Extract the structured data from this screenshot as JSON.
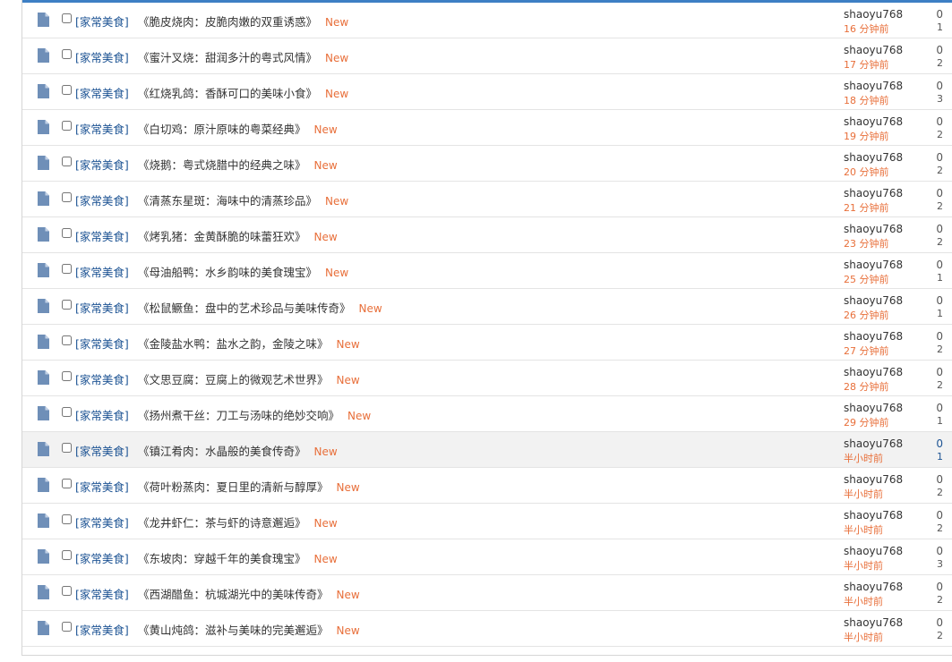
{
  "threads": [
    {
      "category": "[家常美食]",
      "title": "《脆皮烧肉：皮脆肉嫩的双重诱惑》",
      "badge": "New",
      "author": "shaoyu768",
      "time": "16 分钟前",
      "replies": "0",
      "views": "1"
    },
    {
      "category": "[家常美食]",
      "title": "《蜜汁叉烧：甜润多汁的粤式风情》",
      "badge": "New",
      "author": "shaoyu768",
      "time": "17 分钟前",
      "replies": "0",
      "views": "2"
    },
    {
      "category": "[家常美食]",
      "title": "《红烧乳鸽：香酥可口的美味小食》",
      "badge": "New",
      "author": "shaoyu768",
      "time": "18 分钟前",
      "replies": "0",
      "views": "3"
    },
    {
      "category": "[家常美食]",
      "title": "《白切鸡：原汁原味的粤菜经典》",
      "badge": "New",
      "author": "shaoyu768",
      "time": "19 分钟前",
      "replies": "0",
      "views": "2"
    },
    {
      "category": "[家常美食]",
      "title": "《烧鹅：粤式烧腊中的经典之味》",
      "badge": "New",
      "author": "shaoyu768",
      "time": "20 分钟前",
      "replies": "0",
      "views": "2"
    },
    {
      "category": "[家常美食]",
      "title": "《清蒸东星斑：海味中的清蒸珍品》",
      "badge": "New",
      "author": "shaoyu768",
      "time": "21 分钟前",
      "replies": "0",
      "views": "2"
    },
    {
      "category": "[家常美食]",
      "title": "《烤乳猪：金黄酥脆的味蕾狂欢》",
      "badge": "New",
      "author": "shaoyu768",
      "time": "23 分钟前",
      "replies": "0",
      "views": "2"
    },
    {
      "category": "[家常美食]",
      "title": "《母油船鸭：水乡韵味的美食瑰宝》",
      "badge": "New",
      "author": "shaoyu768",
      "time": "25 分钟前",
      "replies": "0",
      "views": "1"
    },
    {
      "category": "[家常美食]",
      "title": "《松鼠鳜鱼：盘中的艺术珍品与美味传奇》",
      "badge": "New",
      "author": "shaoyu768",
      "time": "26 分钟前",
      "replies": "0",
      "views": "1"
    },
    {
      "category": "[家常美食]",
      "title": "《金陵盐水鸭：盐水之韵，金陵之味》",
      "badge": "New",
      "author": "shaoyu768",
      "time": "27 分钟前",
      "replies": "0",
      "views": "2"
    },
    {
      "category": "[家常美食]",
      "title": "《文思豆腐：豆腐上的微观艺术世界》",
      "badge": "New",
      "author": "shaoyu768",
      "time": "28 分钟前",
      "replies": "0",
      "views": "2"
    },
    {
      "category": "[家常美食]",
      "title": "《扬州煮干丝：刀工与汤味的绝妙交响》",
      "badge": "New",
      "author": "shaoyu768",
      "time": "29 分钟前",
      "replies": "0",
      "views": "1"
    },
    {
      "category": "[家常美食]",
      "title": "《镇江肴肉：水晶般的美食传奇》",
      "badge": "New",
      "author": "shaoyu768",
      "time": "半小时前",
      "replies": "0",
      "views": "1",
      "hovered": true
    },
    {
      "category": "[家常美食]",
      "title": "《荷叶粉蒸肉：夏日里的清新与醇厚》",
      "badge": "New",
      "author": "shaoyu768",
      "time": "半小时前",
      "replies": "0",
      "views": "2"
    },
    {
      "category": "[家常美食]",
      "title": "《龙井虾仁：茶与虾的诗意邂逅》",
      "badge": "New",
      "author": "shaoyu768",
      "time": "半小时前",
      "replies": "0",
      "views": "2"
    },
    {
      "category": "[家常美食]",
      "title": "《东坡肉：穿越千年的美食瑰宝》",
      "badge": "New",
      "author": "shaoyu768",
      "time": "半小时前",
      "replies": "0",
      "views": "3"
    },
    {
      "category": "[家常美食]",
      "title": "《西湖醋鱼：杭城湖光中的美味传奇》",
      "badge": "New",
      "author": "shaoyu768",
      "time": "半小时前",
      "replies": "0",
      "views": "2"
    },
    {
      "category": "[家常美食]",
      "title": "《黄山炖鸽：滋补与美味的完美邂逅》",
      "badge": "New",
      "author": "shaoyu768",
      "time": "半小时前",
      "replies": "0",
      "views": "2"
    }
  ],
  "icons": {
    "row_icon": "document-icon"
  },
  "colors": {
    "accent": "#3d7fc4",
    "category": "#1e5494",
    "new_badge": "#e86f3a",
    "time": "#e86f3a",
    "hover_bg": "#f2f2f2",
    "icon": "#6f8fb8"
  }
}
